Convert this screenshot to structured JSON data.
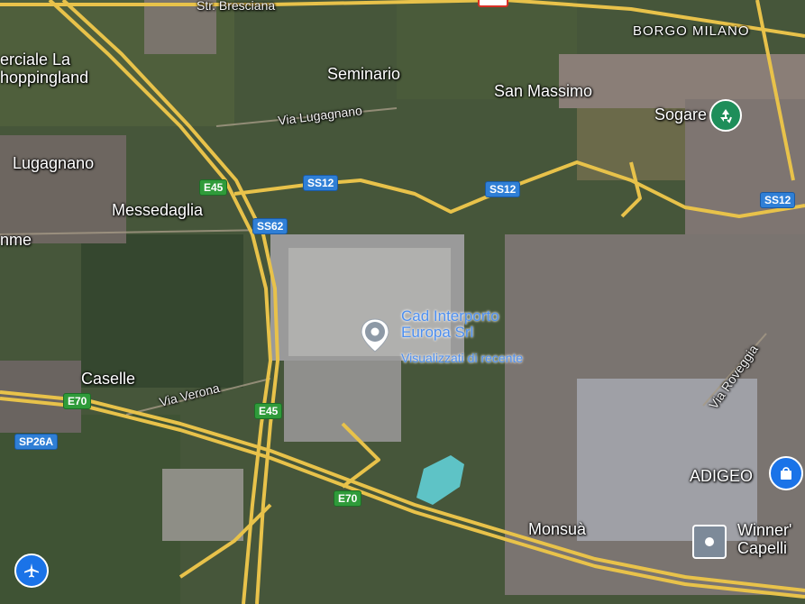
{
  "map": {
    "roads": {
      "str_bresciana": "Str. Bresciana",
      "via_lugagnano": "Via Lugagnano",
      "via_verona": "Via Verona",
      "via_roveggia": "Via Roveggia"
    },
    "places": {
      "borgo_milano": "BORGO MILANO",
      "seminario": "Seminario",
      "san_massimo": "San Massimo",
      "sogare": "Sogare",
      "lugagnano": "Lugagnano",
      "messedaglia": "Messedaglia",
      "caselle": "Caselle",
      "adigeo": "ADIGEO",
      "monsua": "Monsuà",
      "shoppingland_line1": "erciale La",
      "shoppingland_line2": "hoppingland",
      "left_edge": "nme",
      "winners_line1": "Winner'",
      "winners_line2": "Capelli"
    },
    "shields": {
      "ss12_a": "SS12",
      "ss12_b": "SS12",
      "ss12_c": "SS12",
      "ss62": "SS62",
      "e45_a": "E45",
      "e45_b": "E45",
      "e70_a": "E70",
      "e70_b": "E70",
      "sp26a": "SP26A"
    },
    "selected_poi": {
      "name_line1": "Cad Interporto",
      "name_line2": "Europa Srl",
      "subtitle": "Visualizzati di recente",
      "icon": "map-pin-icon"
    },
    "icons": {
      "sogare": "recycling-icon",
      "adigeo": "shopping-bag-icon",
      "winners": "barber-shop-icon",
      "airport": "airplane-icon"
    },
    "colors": {
      "poi_blue": "#4d8ff0",
      "highway_yellow": "#e8c24a",
      "shield_blue": "#2f7fd6",
      "shield_green": "#2f9b3a",
      "recycling_green": "#1e8e5a"
    }
  }
}
